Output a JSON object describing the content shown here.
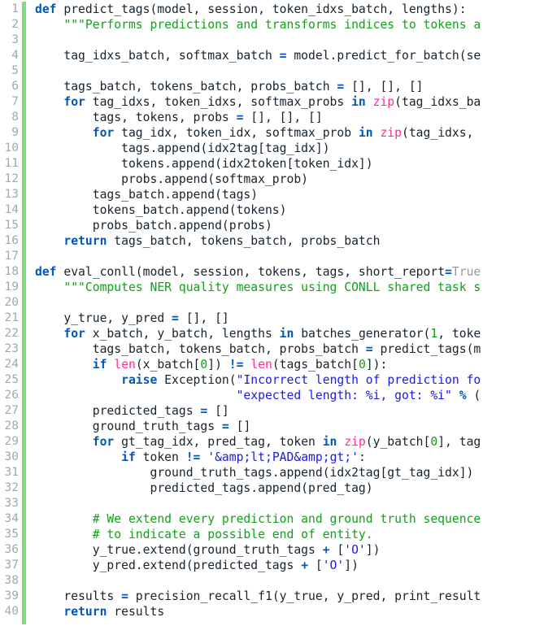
{
  "editor": {
    "language": "python",
    "line_count": 40,
    "gutter_color": "#a0a8b0",
    "marker_color": "#7fdd7f",
    "background": "#ffffff",
    "foreground": "#16232e"
  },
  "theme_colors": {
    "keyword": "#0057b7",
    "builtin": "#ff2e92",
    "string": "#1a1ae6",
    "comment": "#11a11a",
    "docstring": "#11a11a",
    "number": "#1a9c1a",
    "constant": "#8f9aa6",
    "identifier": "#16232e"
  },
  "line_numbers": [
    "1",
    "2",
    "3",
    "4",
    "5",
    "6",
    "7",
    "8",
    "9",
    "10",
    "11",
    "12",
    "13",
    "14",
    "15",
    "16",
    "17",
    "18",
    "19",
    "20",
    "21",
    "22",
    "23",
    "24",
    "25",
    "26",
    "27",
    "28",
    "29",
    "30",
    "31",
    "32",
    "33",
    "34",
    "35",
    "36",
    "37",
    "38",
    "39",
    "40"
  ],
  "code_lines": [
    "def predict_tags(model, session, token_idxs_batch, lengths):",
    "    \"\"\"Performs predictions and transforms indices to tokens a",
    "",
    "    tag_idxs_batch, softmax_batch = model.predict_for_batch(se",
    "",
    "    tags_batch, tokens_batch, probs_batch = [], [], []",
    "    for tag_idxs, token_idxs, softmax_probs in zip(tag_idxs_ba",
    "        tags, tokens, probs = [], [], []",
    "        for tag_idx, token_idx, softmax_prob in zip(tag_idxs, ",
    "            tags.append(idx2tag[tag_idx])",
    "            tokens.append(idx2token[token_idx])",
    "            probs.append(softmax_prob)",
    "        tags_batch.append(tags)",
    "        tokens_batch.append(tokens)",
    "        probs_batch.append(probs)",
    "    return tags_batch, tokens_batch, probs_batch",
    "",
    "def eval_conll(model, session, tokens, tags, short_report=True",
    "    \"\"\"Computes NER quality measures using CONLL shared task s",
    "",
    "    y_true, y_pred = [], []",
    "    for x_batch, y_batch, lengths in batches_generator(1, toke",
    "        tags_batch, tokens_batch, probs_batch = predict_tags(m",
    "        if len(x_batch[0]) != len(tags_batch[0]):",
    "            raise Exception(\"Incorrect length of prediction fo",
    "                            \"expected length: %i, got: %i\" % (",
    "        predicted_tags = []",
    "        ground_truth_tags = []",
    "        for gt_tag_idx, pred_tag, token in zip(y_batch[0], tag",
    "            if token != '&amp;lt;PAD&amp;gt;':",
    "                ground_truth_tags.append(idx2tag[gt_tag_idx])",
    "                predicted_tags.append(pred_tag)",
    "",
    "        # We extend every prediction and ground truth sequence",
    "        # to indicate a possible end of entity.",
    "        y_true.extend(ground_truth_tags + ['O'])",
    "        y_pred.extend(predicted_tags + ['O'])",
    "",
    "    results = precision_recall_f1(y_true, y_pred, print_result",
    "    return results"
  ],
  "tokenized_lines": [
    [
      [
        "k",
        "def"
      ],
      [
        "id",
        " predict_tags(model, session, token_idxs_batch, lengths):"
      ]
    ],
    [
      [
        "ds",
        "    \"\"\"Performs predictions and transforms indices to tokens a"
      ]
    ],
    [
      [
        "id",
        ""
      ]
    ],
    [
      [
        "id",
        "    tag_idxs_batch, softmax_batch "
      ],
      [
        "o",
        "="
      ],
      [
        "id",
        " model.predict_for_batch(se"
      ]
    ],
    [
      [
        "id",
        ""
      ]
    ],
    [
      [
        "id",
        "    tags_batch, tokens_batch, probs_batch "
      ],
      [
        "o",
        "="
      ],
      [
        "id",
        " [], [], []"
      ]
    ],
    [
      [
        "id",
        "    "
      ],
      [
        "k",
        "for"
      ],
      [
        "id",
        " tag_idxs, token_idxs, softmax_probs "
      ],
      [
        "k",
        "in"
      ],
      [
        "id",
        " "
      ],
      [
        "bi",
        "zip"
      ],
      [
        "id",
        "(tag_idxs_ba"
      ]
    ],
    [
      [
        "id",
        "        tags, tokens, probs "
      ],
      [
        "o",
        "="
      ],
      [
        "id",
        " [], [], []"
      ]
    ],
    [
      [
        "id",
        "        "
      ],
      [
        "k",
        "for"
      ],
      [
        "id",
        " tag_idx, token_idx, softmax_prob "
      ],
      [
        "k",
        "in"
      ],
      [
        "id",
        " "
      ],
      [
        "bi",
        "zip"
      ],
      [
        "id",
        "(tag_idxs, "
      ]
    ],
    [
      [
        "id",
        "            tags.append(idx2tag[tag_idx])"
      ]
    ],
    [
      [
        "id",
        "            tokens.append(idx2token[token_idx])"
      ]
    ],
    [
      [
        "id",
        "            probs.append(softmax_prob)"
      ]
    ],
    [
      [
        "id",
        "        tags_batch.append(tags)"
      ]
    ],
    [
      [
        "id",
        "        tokens_batch.append(tokens)"
      ]
    ],
    [
      [
        "id",
        "        probs_batch.append(probs)"
      ]
    ],
    [
      [
        "id",
        "    "
      ],
      [
        "k",
        "return"
      ],
      [
        "id",
        " tags_batch, tokens_batch, probs_batch"
      ]
    ],
    [
      [
        "id",
        ""
      ]
    ],
    [
      [
        "k",
        "def"
      ],
      [
        "id",
        " eval_conll(model, session, tokens, tags, short_report"
      ],
      [
        "o",
        "="
      ],
      [
        "cst",
        "True"
      ]
    ],
    [
      [
        "ds",
        "    \"\"\"Computes NER quality measures using CONLL shared task s"
      ]
    ],
    [
      [
        "id",
        ""
      ]
    ],
    [
      [
        "id",
        "    y_true, y_pred "
      ],
      [
        "o",
        "="
      ],
      [
        "id",
        " [], []"
      ]
    ],
    [
      [
        "id",
        "    "
      ],
      [
        "k",
        "for"
      ],
      [
        "id",
        " x_batch, y_batch, lengths "
      ],
      [
        "k",
        "in"
      ],
      [
        "id",
        " batches_generator("
      ],
      [
        "n",
        "1"
      ],
      [
        "id",
        ", toke"
      ]
    ],
    [
      [
        "id",
        "        tags_batch, tokens_batch, probs_batch "
      ],
      [
        "o",
        "="
      ],
      [
        "id",
        " predict_tags(m"
      ]
    ],
    [
      [
        "id",
        "        "
      ],
      [
        "k",
        "if"
      ],
      [
        "id",
        " "
      ],
      [
        "bi",
        "len"
      ],
      [
        "id",
        "(x_batch["
      ],
      [
        "n",
        "0"
      ],
      [
        "id",
        "]) "
      ],
      [
        "o",
        "!="
      ],
      [
        "id",
        " "
      ],
      [
        "bi",
        "len"
      ],
      [
        "id",
        "(tags_batch["
      ],
      [
        "n",
        "0"
      ],
      [
        "id",
        "]):"
      ]
    ],
    [
      [
        "id",
        "            "
      ],
      [
        "k",
        "raise"
      ],
      [
        "id",
        " Exception("
      ],
      [
        "s",
        "\"Incorrect length of prediction fo"
      ]
    ],
    [
      [
        "id",
        "                            "
      ],
      [
        "s",
        "\"expected length: %i, got: %i\""
      ],
      [
        "id",
        " "
      ],
      [
        "o",
        "%"
      ],
      [
        "id",
        " ("
      ]
    ],
    [
      [
        "id",
        "        predicted_tags "
      ],
      [
        "o",
        "="
      ],
      [
        "id",
        " []"
      ]
    ],
    [
      [
        "id",
        "        ground_truth_tags "
      ],
      [
        "o",
        "="
      ],
      [
        "id",
        " []"
      ]
    ],
    [
      [
        "id",
        "        "
      ],
      [
        "k",
        "for"
      ],
      [
        "id",
        " gt_tag_idx, pred_tag, token "
      ],
      [
        "k",
        "in"
      ],
      [
        "id",
        " "
      ],
      [
        "bi",
        "zip"
      ],
      [
        "id",
        "(y_batch["
      ],
      [
        "n",
        "0"
      ],
      [
        "id",
        "], tag"
      ]
    ],
    [
      [
        "id",
        "            "
      ],
      [
        "k",
        "if"
      ],
      [
        "id",
        " token "
      ],
      [
        "o",
        "!="
      ],
      [
        "id",
        " "
      ],
      [
        "s",
        "'&amp;lt;PAD&amp;gt;'"
      ],
      [
        "id",
        ":"
      ]
    ],
    [
      [
        "id",
        "                ground_truth_tags.append(idx2tag[gt_tag_idx])"
      ]
    ],
    [
      [
        "id",
        "                predicted_tags.append(pred_tag)"
      ]
    ],
    [
      [
        "id",
        ""
      ]
    ],
    [
      [
        "c",
        "        # We extend every prediction and ground truth sequence"
      ]
    ],
    [
      [
        "c",
        "        # to indicate a possible end of entity."
      ]
    ],
    [
      [
        "id",
        "        y_true.extend(ground_truth_tags "
      ],
      [
        "o",
        "+"
      ],
      [
        "id",
        " ["
      ],
      [
        "s",
        "'O'"
      ],
      [
        "id",
        "])"
      ]
    ],
    [
      [
        "id",
        "        y_pred.extend(predicted_tags "
      ],
      [
        "o",
        "+"
      ],
      [
        "id",
        " ["
      ],
      [
        "s",
        "'O'"
      ],
      [
        "id",
        "])"
      ]
    ],
    [
      [
        "id",
        ""
      ]
    ],
    [
      [
        "id",
        "    results "
      ],
      [
        "o",
        "="
      ],
      [
        "id",
        " precision_recall_f1(y_true, y_pred, print_result"
      ]
    ],
    [
      [
        "id",
        "    "
      ],
      [
        "k",
        "return"
      ],
      [
        "id",
        " results"
      ]
    ]
  ]
}
